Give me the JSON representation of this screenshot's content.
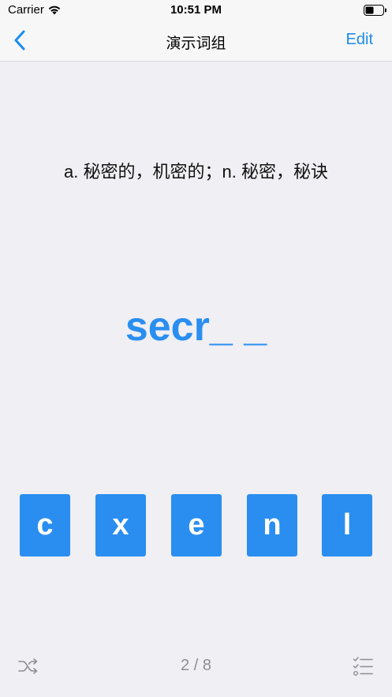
{
  "status": {
    "carrier": "Carrier",
    "time": "10:51 PM"
  },
  "nav": {
    "title": "演示词组",
    "edit_label": "Edit"
  },
  "card": {
    "definition": "a. 秘密的，机密的；n. 秘密，秘诀",
    "word_display": "secr_ _"
  },
  "letters": [
    "c",
    "x",
    "e",
    "n",
    "l"
  ],
  "footer": {
    "page_indicator": "2 / 8"
  },
  "colors": {
    "accent": "#2a8ef0",
    "background": "#efeff4",
    "nav_background": "#f7f7f7",
    "secondary_text": "#8e8e93"
  },
  "icons": {
    "back": "chevron-left-icon",
    "shuffle": "shuffle-icon",
    "list": "checklist-icon",
    "wifi": "wifi-icon",
    "battery": "battery-icon"
  }
}
